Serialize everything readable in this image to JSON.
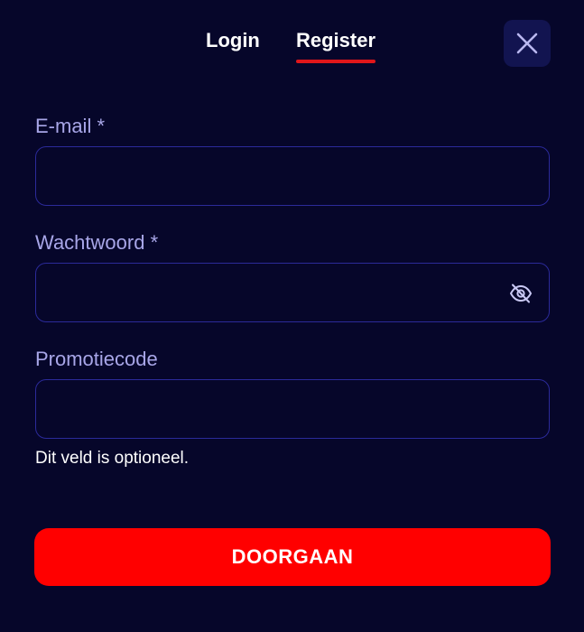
{
  "tabs": {
    "login_label": "Login",
    "register_label": "Register",
    "active": "register"
  },
  "close": {
    "icon": "close-icon"
  },
  "form": {
    "email": {
      "label": "E-mail *",
      "value": ""
    },
    "password": {
      "label": "Wachtwoord *",
      "value": "",
      "toggle_icon": "eye-off-icon"
    },
    "promo": {
      "label": "Promotiecode",
      "value": "",
      "helper": "Dit veld is optioneel."
    },
    "submit_label": "DOORGAAN"
  },
  "colors": {
    "background": "#06062a",
    "accent": "#ff0000",
    "label": "#a8a6e8",
    "input_border": "#2b2a9a",
    "close_bg": "#121450"
  }
}
